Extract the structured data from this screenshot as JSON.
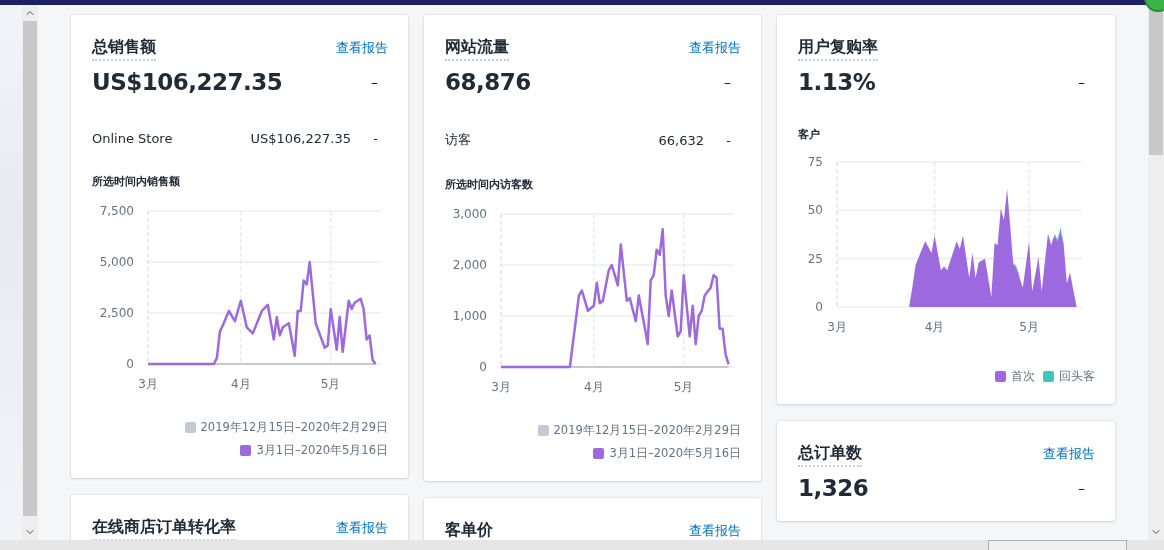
{
  "columns": [
    {
      "cards": [
        {
          "title": "总销售额",
          "link": "查看报告",
          "value": "US$106,227.35",
          "change": "–",
          "breakdown": [
            {
              "label": "Online Store",
              "value": "US$106,227.35",
              "change": "-"
            }
          ],
          "chart_title": "所选时间内销售额",
          "chart_data": {
            "type": "line",
            "categories": [
              "3月",
              null,
              null,
              null,
              null,
              null,
              null,
              null,
              null,
              null,
              null,
              null,
              null,
              null,
              null,
              null,
              null,
              null,
              null,
              null,
              null,
              null,
              null,
              null,
              null,
              null,
              null,
              null,
              null,
              null,
              null,
              "4月",
              null,
              null,
              null,
              null,
              null,
              null,
              null,
              null,
              null,
              null,
              null,
              null,
              null,
              null,
              null,
              null,
              null,
              null,
              null,
              null,
              null,
              null,
              null,
              null,
              null,
              null,
              null,
              null,
              null,
              "5月",
              null,
              null,
              null,
              null,
              null,
              null,
              null,
              null,
              null,
              null,
              null,
              null,
              null,
              null,
              null
            ],
            "grid": true,
            "ylim": [
              0,
              7500
            ],
            "yticks": [
              {
                "value": 0,
                "label": "0"
              },
              {
                "value": 2500,
                "label": "2,500"
              },
              {
                "value": 5000,
                "label": "5,000"
              },
              {
                "value": 7500,
                "label": "7,500"
              }
            ],
            "series": [
              {
                "name": "2019年12月15日–2020年2月29日",
                "color": "#c4c9d6",
                "values": [
                  0,
                  0,
                  0,
                  0,
                  0,
                  0,
                  0,
                  0,
                  0,
                  0,
                  0,
                  0,
                  0,
                  0,
                  0,
                  0,
                  0,
                  0,
                  0,
                  0,
                  0,
                  0,
                  0,
                  0,
                  0,
                  0,
                  0,
                  0,
                  0,
                  0,
                  0,
                  0,
                  0,
                  0,
                  0,
                  0,
                  0,
                  0,
                  0,
                  0,
                  0,
                  0,
                  0,
                  0,
                  0,
                  0,
                  0,
                  0,
                  0,
                  0,
                  0,
                  0,
                  0,
                  0,
                  0,
                  0,
                  0,
                  0,
                  0,
                  0,
                  0,
                  0,
                  0,
                  0,
                  0,
                  0,
                  0,
                  0,
                  0,
                  0,
                  0,
                  0,
                  0,
                  0,
                  0,
                  0,
                  0
                ]
              },
              {
                "name": "3月1日–2020年5月16日",
                "color": "#9c6ade",
                "values": [
                  0,
                  0,
                  0,
                  0,
                  0,
                  0,
                  0,
                  0,
                  0,
                  0,
                  0,
                  0,
                  0,
                  0,
                  0,
                  0,
                  0,
                  0,
                  0,
                  0,
                  0,
                  0,
                  0,
                  300,
                  1600,
                  1900,
                  2250,
                  2600,
                  2350,
                  2100,
                  2600,
                  3100,
                  2450,
                  1800,
                  1650,
                  1500,
                  1870,
                  2230,
                  2600,
                  2750,
                  2900,
                  2050,
                  1200,
                  2300,
                  1400,
                  1800,
                  1900,
                  2000,
                  1200,
                  400,
                  2600,
                  2600,
                  4100,
                  3900,
                  5000,
                  3500,
                  2000,
                  1600,
                  1200,
                  800,
                  900,
                  2700,
                  1700,
                  700,
                  2300,
                  600,
                  1850,
                  3100,
                  2700,
                  3000,
                  3100,
                  3200,
                  2700,
                  1200,
                  1400,
                  200,
                  0
                ]
              }
            ]
          }
        },
        {
          "title": "在线商店订单转化率",
          "link": "查看报告"
        }
      ]
    },
    {
      "cards": [
        {
          "title": "网站流量",
          "link": "查看报告",
          "value": "68,876",
          "change": "–",
          "breakdown": [
            {
              "label": "访客",
              "value": "66,632",
              "change": "-"
            }
          ],
          "chart_title": "所选时间内访客数",
          "chart_data": {
            "type": "line",
            "categories": [
              "3月",
              null,
              null,
              null,
              null,
              null,
              null,
              null,
              null,
              null,
              null,
              null,
              null,
              null,
              null,
              null,
              null,
              null,
              null,
              null,
              null,
              null,
              null,
              null,
              null,
              null,
              null,
              null,
              null,
              null,
              null,
              "4月",
              null,
              null,
              null,
              null,
              null,
              null,
              null,
              null,
              null,
              null,
              null,
              null,
              null,
              null,
              null,
              null,
              null,
              null,
              null,
              null,
              null,
              null,
              null,
              null,
              null,
              null,
              null,
              null,
              null,
              "5月",
              null,
              null,
              null,
              null,
              null,
              null,
              null,
              null,
              null,
              null,
              null,
              null,
              null,
              null,
              null
            ],
            "grid": true,
            "ylim": [
              0,
              3000
            ],
            "yticks": [
              {
                "value": 0,
                "label": "0"
              },
              {
                "value": 1000,
                "label": "1,000"
              },
              {
                "value": 2000,
                "label": "2,000"
              },
              {
                "value": 3000,
                "label": "3,000"
              }
            ],
            "series": [
              {
                "name": "2019年12月15日–2020年2月29日",
                "color": "#c4c9d6",
                "values": [
                  0,
                  0,
                  0,
                  0,
                  0,
                  0,
                  0,
                  0,
                  0,
                  0,
                  0,
                  0,
                  0,
                  0,
                  0,
                  0,
                  0,
                  0,
                  0,
                  0,
                  0,
                  0,
                  0,
                  0,
                  0,
                  0,
                  0,
                  0,
                  0,
                  0,
                  0,
                  0,
                  0,
                  0,
                  0,
                  0,
                  0,
                  0,
                  0,
                  0,
                  0,
                  0,
                  0,
                  0,
                  0,
                  0,
                  0,
                  0,
                  0,
                  0,
                  0,
                  0,
                  0,
                  0,
                  0,
                  0,
                  0,
                  0,
                  0,
                  0,
                  0,
                  0,
                  0,
                  0,
                  0,
                  0,
                  0,
                  0,
                  0,
                  0,
                  0,
                  0,
                  0,
                  0,
                  0,
                  0,
                  0
                ]
              },
              {
                "name": "3月1日–2020年5月16日",
                "color": "#9c6ade",
                "values": [
                  0,
                  0,
                  0,
                  0,
                  0,
                  0,
                  0,
                  0,
                  0,
                  0,
                  0,
                  0,
                  0,
                  0,
                  0,
                  0,
                  0,
                  0,
                  0,
                  0,
                  0,
                  0,
                  0,
                  0,
                  470,
                  930,
                  1400,
                  1500,
                  1300,
                  1100,
                  1150,
                  1200,
                  1650,
                  1250,
                  1300,
                  1600,
                  1900,
                  2000,
                  1800,
                  1600,
                  2400,
                  1850,
                  1300,
                  1350,
                  1120,
                  900,
                  1400,
                  1080,
                  770,
                  450,
                  1700,
                  1800,
                  2300,
                  2200,
                  2700,
                  1400,
                  1000,
                  1500,
                  1050,
                  600,
                  700,
                  1800,
                  1200,
                  600,
                  1200,
                  450,
                  1000,
                  1100,
                  1400,
                  1480,
                  1550,
                  1800,
                  1750,
                  750,
                  750,
                  250,
                  50
                ]
              }
            ]
          }
        },
        {
          "title": "客单价",
          "link": "查看报告"
        }
      ]
    },
    {
      "cards": [
        {
          "title": "用户复购率",
          "value": "1.13%",
          "change": "–",
          "chart_title": "客户",
          "chart_data": {
            "type": "area",
            "stacked": true,
            "grid": true,
            "categories": [
              "3月",
              null,
              null,
              null,
              null,
              null,
              null,
              null,
              null,
              null,
              null,
              null,
              null,
              null,
              null,
              null,
              null,
              null,
              null,
              null,
              null,
              null,
              null,
              null,
              null,
              null,
              null,
              null,
              null,
              null,
              null,
              "4月",
              null,
              null,
              null,
              null,
              null,
              null,
              null,
              null,
              null,
              null,
              null,
              null,
              null,
              null,
              null,
              null,
              null,
              null,
              null,
              null,
              null,
              null,
              null,
              null,
              null,
              null,
              null,
              null,
              null,
              "5月",
              null,
              null,
              null,
              null,
              null,
              null,
              null,
              null,
              null,
              null,
              null,
              null,
              null,
              null,
              null
            ],
            "ylim": [
              0,
              75
            ],
            "yticks": [
              0,
              25,
              50,
              75
            ],
            "series": [
              {
                "name": "首次",
                "color": "#9c6ade",
                "values": [
                  null,
                  null,
                  null,
                  null,
                  null,
                  null,
                  null,
                  null,
                  null,
                  null,
                  null,
                  null,
                  null,
                  null,
                  null,
                  null,
                  null,
                  null,
                  null,
                  null,
                  null,
                  null,
                  null,
                  1,
                  11,
                  22,
                  26,
                  30,
                  34,
                  31,
                  28,
                  37,
                  28,
                  19,
                  21,
                  19,
                  24,
                  29,
                  34,
                  30,
                  37,
                  26,
                  15,
                  28,
                  15,
                  23,
                  24,
                  25,
                  15,
                  5,
                  33,
                  32,
                  51,
                  45,
                  61,
                  42,
                  22,
                  20,
                  15,
                  10,
                  22,
                  34,
                  8,
                  17,
                  26,
                  8,
                  23,
                  38,
                  32,
                  37,
                  34,
                  39,
                  32,
                  12,
                  18,
                  9,
                  1
                ]
              },
              {
                "name": "回头客",
                "color": "#47c1bf",
                "values": [
                  null,
                  null,
                  null,
                  null,
                  null,
                  null,
                  null,
                  null,
                  null,
                  null,
                  null,
                  null,
                  null,
                  null,
                  null,
                  null,
                  null,
                  null,
                  null,
                  null,
                  null,
                  null,
                  null,
                  null,
                  null,
                  null,
                  null,
                  null,
                  null,
                  null,
                  null,
                  null,
                  null,
                  null,
                  null,
                  null,
                  null,
                  null,
                  null,
                  null,
                  null,
                  null,
                  null,
                  null,
                  null,
                  null,
                  null,
                  null,
                  null,
                  null,
                  null,
                  null,
                  null,
                  null,
                  null,
                  null,
                  1,
                  1,
                  1,
                  null,
                  null,
                  null,
                  null,
                  null,
                  null,
                  null,
                  null,
                  null,
                  null,
                  1,
                  1,
                  2,
                  1,
                  null,
                  null,
                  null,
                  null
                ]
              }
            ]
          }
        },
        {
          "title": "总订单数",
          "link": "查看报告",
          "value": "1,326",
          "change": "–"
        }
      ]
    }
  ]
}
